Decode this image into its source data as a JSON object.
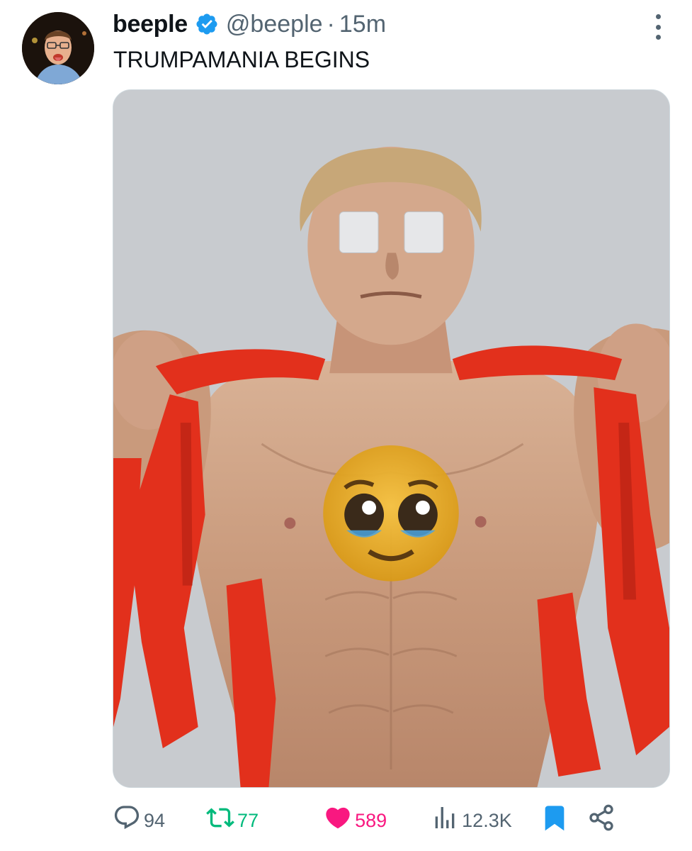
{
  "tweet": {
    "author": {
      "display_name": "beeple",
      "handle": "@beeple",
      "verified": true,
      "avatar_icon": "avatar-photo"
    },
    "separator": "·",
    "time": "15m",
    "text": "TRUMPAMANIA BEGINS",
    "media": {
      "kind": "image",
      "icon": "photo-image"
    },
    "actions": {
      "reply_count": "94",
      "retweet_count": "77",
      "like_count": "589",
      "view_count": "12.3K",
      "bookmarked": true,
      "liked": true,
      "retweeted": true
    }
  },
  "colors": {
    "accent": "#1d9bf0",
    "retweet_green": "#00ba7c",
    "like_pink": "#f91880",
    "muted": "#536471",
    "text": "#0f1419"
  },
  "icons": {
    "more": "more-icon",
    "verified": "verified-badge-icon",
    "reply": "reply-icon",
    "retweet": "retweet-icon",
    "like": "heart-icon",
    "views": "views-icon",
    "bookmark": "bookmark-icon",
    "share": "share-icon"
  }
}
